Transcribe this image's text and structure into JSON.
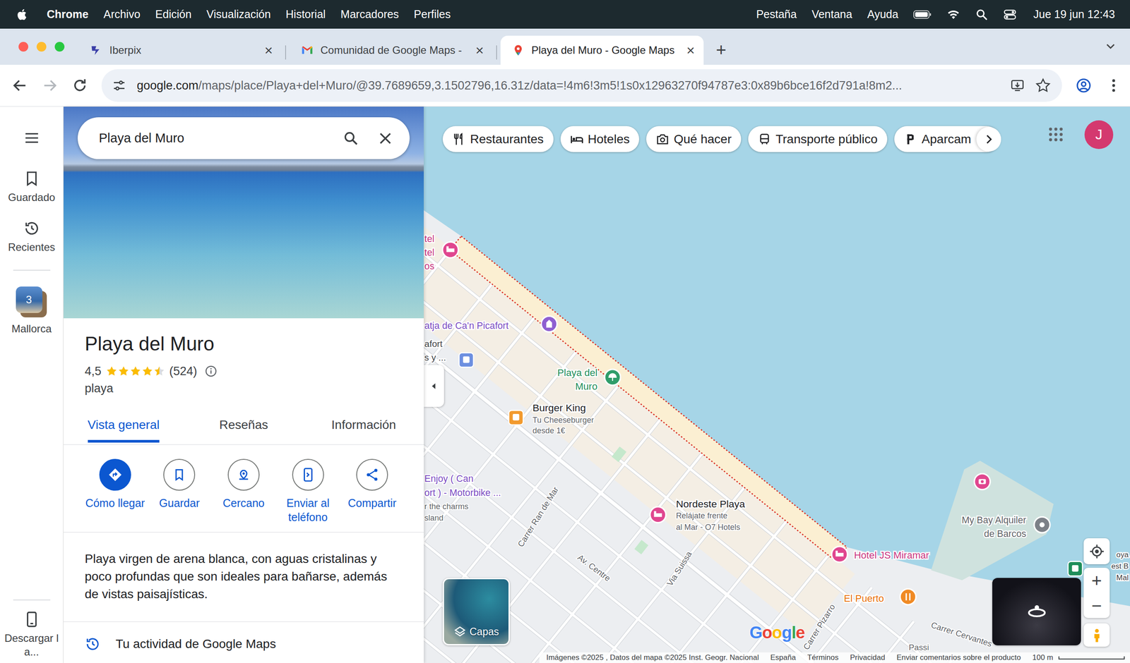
{
  "menubar": {
    "app": "Chrome",
    "menus": [
      "Archivo",
      "Edición",
      "Visualización",
      "Historial",
      "Marcadores",
      "Perfiles"
    ],
    "right_menus": [
      "Pestaña",
      "Ventana",
      "Ayuda"
    ],
    "clock": "Jue 19 jun 12:43"
  },
  "browser": {
    "tabs": [
      {
        "label": "Iberpix",
        "selected": false
      },
      {
        "label": "Comunidad de Google Maps -",
        "selected": false
      },
      {
        "label": "Playa del Muro - Google Maps",
        "selected": true
      }
    ],
    "close_glyph": "×",
    "new_tab": "+",
    "url_host": "google.com",
    "url_rest": "/maps/place/Playa+del+Muro/@39.7689659,3.1502796,16.31z/data=!4m6!3m5!1s0x12963270f94787e3:0x89b6bce16f2d791a!8m2..."
  },
  "rail": {
    "items": [
      {
        "label": "Guardado"
      },
      {
        "label": "Recientes"
      }
    ],
    "collection": {
      "label": "Mallorca",
      "badge": "3"
    },
    "download": "Descargar la..."
  },
  "place": {
    "search": "Playa del Muro",
    "title": "Playa del Muro",
    "rating": "4,5",
    "stars": 4.5,
    "reviews": "(524)",
    "category": "playa",
    "tabs": [
      {
        "label": "Vista general",
        "selected": true
      },
      {
        "label": "Reseñas",
        "selected": false
      },
      {
        "label": "Información",
        "selected": false
      }
    ],
    "actions": [
      {
        "label": "Cómo llegar",
        "primary": true
      },
      {
        "label": "Guardar",
        "primary": false
      },
      {
        "label": "Cercano",
        "primary": false
      },
      {
        "label": "Enviar al teléfono",
        "primary": false
      },
      {
        "label": "Compartir",
        "primary": false
      }
    ],
    "description": "Playa virgen de arena blanca, con aguas cristalinas y poco profundas que son ideales para bañarse, además de vistas paisajísticas.",
    "activity": "Tu actividad de Google Maps"
  },
  "map": {
    "chips": [
      "Restaurantes",
      "Hoteles",
      "Qué hacer",
      "Transporte público",
      "Aparcam"
    ],
    "avatar": "J",
    "layers": "Capas",
    "logo": "Google",
    "zoom_in": "+",
    "zoom_out": "−",
    "places": [
      {
        "kind": "hotel",
        "color": "#e0468f",
        "label_color": "#c8357f",
        "title": [
          "tel",
          "tel",
          "os"
        ],
        "sub": []
      },
      {
        "kind": "landmark",
        "color": "#8e5fd1",
        "label_color": "#7a4cc2",
        "title": [
          "atja de Ca'n Picafort"
        ],
        "sub": []
      },
      {
        "kind": "transit",
        "color": "#6d8fe0",
        "label_color": "#3c4043",
        "title": [
          "afort",
          "s y ..."
        ],
        "sub": []
      },
      {
        "kind": "beach",
        "color": "#2f9d6a",
        "label_color": "#1e8e5a",
        "title": [
          "Playa del",
          "Muro"
        ],
        "sub": []
      },
      {
        "kind": "burger",
        "color": "#f29a2e",
        "label_color": "#202124",
        "title": [
          "Burger King"
        ],
        "sub": [
          "Tu Cheeseburger",
          "desde 1€"
        ]
      },
      {
        "kind": "none",
        "color": "#8e5fd1",
        "label_color": "#7a4cc2",
        "title": [
          "Enjoy ( Can",
          "ort ) - Motorbike ..."
        ],
        "sub": [
          "r the charms",
          "sland"
        ]
      },
      {
        "kind": "hotel",
        "color": "#e0468f",
        "label_color": "#202124",
        "title": [
          "Nordeste Playa"
        ],
        "sub": [
          "Relájate frente",
          "al Mar - O7 Hotels"
        ]
      },
      {
        "kind": "hotel",
        "color": "#e0468f",
        "label_color": "#c8357f",
        "title": [
          "Hotel JS Miramar"
        ],
        "sub": []
      },
      {
        "kind": "camera",
        "color": "#e0468f",
        "label_color": "#c8357f",
        "title": [],
        "sub": []
      },
      {
        "kind": "pin",
        "color": "#7c8087",
        "label_color": "#5f6368",
        "title": [
          "My Bay Alquiler",
          "de Barcos"
        ],
        "sub": []
      },
      {
        "kind": "restaurant",
        "color": "#f08a24",
        "label_color": "#e8710a",
        "title": [
          "El Puerto"
        ],
        "sub": []
      },
      {
        "kind": "park",
        "color": "#1e8e5a",
        "label_color": "#3c4043",
        "title": [
          "oya",
          "est B",
          "Mal"
        ],
        "sub": []
      }
    ],
    "roads": [
      "Carrer Ran de Mar",
      "Av. Centre",
      "Via Suissa",
      "Carrer Pizarro",
      "Carrer Cervantes",
      "Passi"
    ],
    "footer": [
      "Imágenes ©2025 , Datos del mapa ©2025 Inst. Geogr. Nacional",
      "España",
      "Términos",
      "Privacidad",
      "Enviar comentarios sobre el producto"
    ],
    "scale": "100 m"
  }
}
